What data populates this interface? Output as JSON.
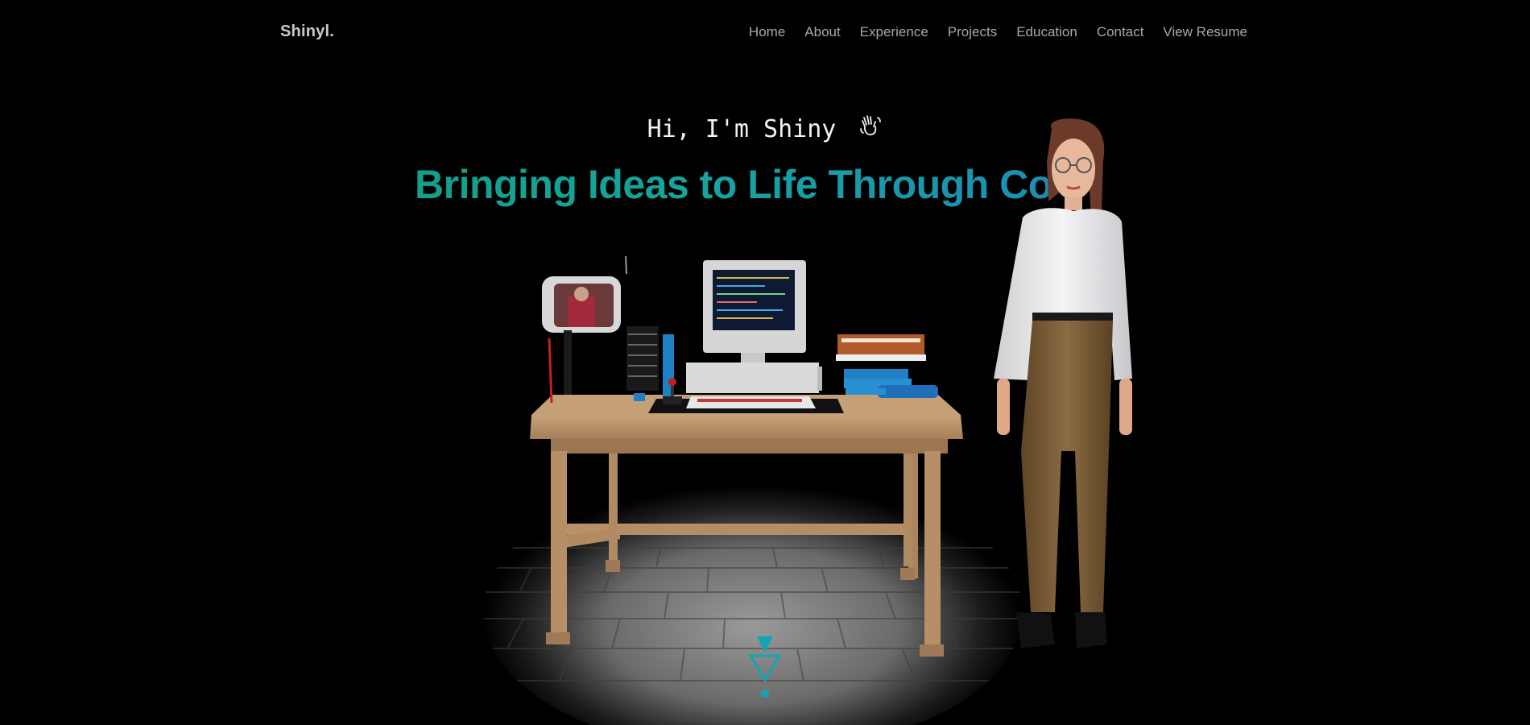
{
  "nav": {
    "logo": "Shinyl.",
    "links": [
      "Home",
      "About",
      "Experience",
      "Projects",
      "Education",
      "Contact",
      "View Resume"
    ]
  },
  "hero": {
    "greeting": "Hi, I'm Shiny",
    "wave_icon": "waving-hand-icon",
    "headline": "Bringing Ideas to Life Through Co"
  },
  "colors": {
    "background": "#000000",
    "accent_teal": "#13a08a",
    "accent_blue": "#1b8fb4",
    "nav_text": "#a8a8a8",
    "scroll_indicator": "#0fa7b5"
  },
  "scene": {
    "objects": [
      "wooden-desk",
      "retro-computer-monitor",
      "small-tv-monitor",
      "keyboard",
      "joystick",
      "stacked-books",
      "avatar-character",
      "stone-tile-floor"
    ]
  }
}
